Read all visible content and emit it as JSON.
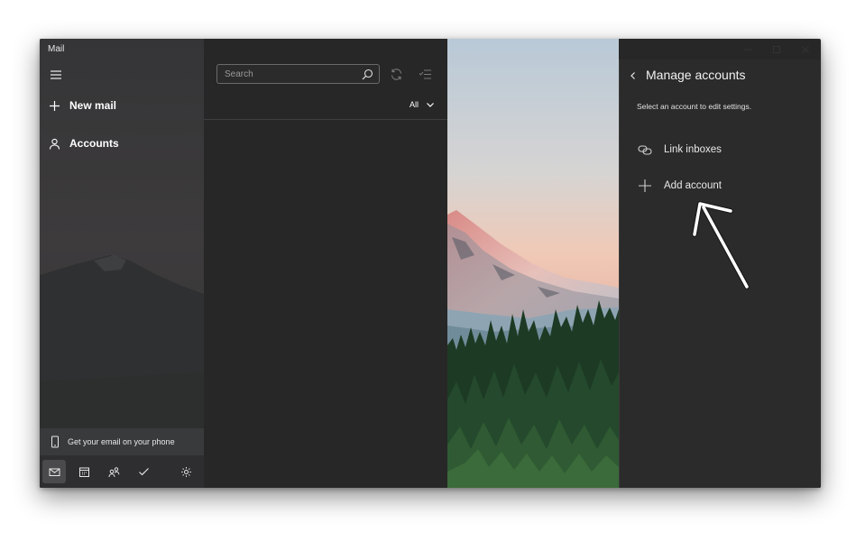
{
  "app": {
    "title": "Mail"
  },
  "sidebar": {
    "new_mail_label": "New mail",
    "accounts_label": "Accounts",
    "phone_promo": "Get your email on your phone",
    "bottom_icons": [
      "mail-icon",
      "calendar-icon",
      "people-icon",
      "todo-icon",
      "settings-icon"
    ]
  },
  "list": {
    "search_placeholder": "Search",
    "filter_label": "All"
  },
  "flyout": {
    "title": "Manage accounts",
    "subtitle": "Select an account to edit settings.",
    "link_inboxes_label": "Link inboxes",
    "add_account_label": "Add account"
  },
  "colors": {
    "accent": "#ffffff",
    "window_bg": "#272727",
    "flyout_bg": "#2b2b2b"
  }
}
